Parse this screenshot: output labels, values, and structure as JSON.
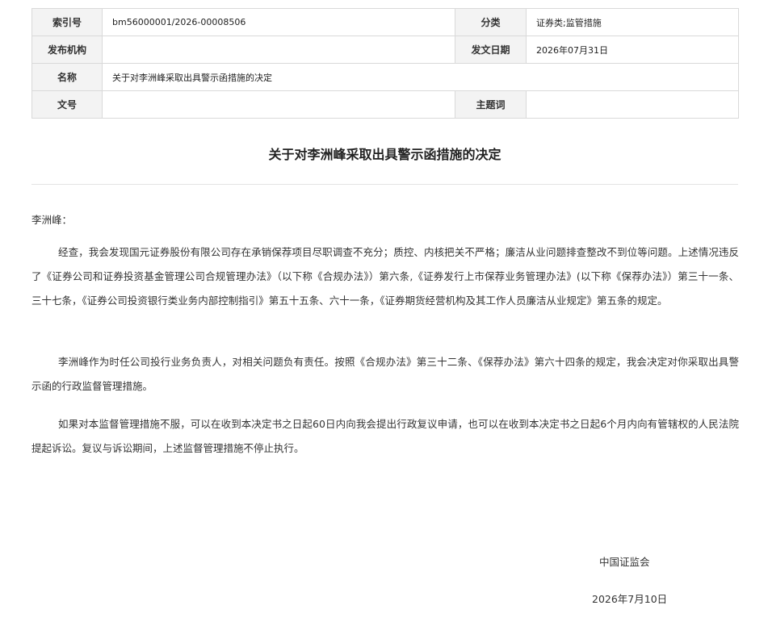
{
  "meta": {
    "index_label": "索引号",
    "index_value": "bm56000001/2026-00008506",
    "category_label": "分类",
    "category_value": "证券类;监管措施",
    "issuer_label": "发布机构",
    "issuer_value": "",
    "issue_date_label": "发文日期",
    "issue_date_value": "2026年07月31日",
    "name_label": "名称",
    "name_value": "关于对李洲峰采取出具警示函措施的决定",
    "doc_no_label": "文号",
    "doc_no_value": "",
    "subject_label": "主题词",
    "subject_value": ""
  },
  "document": {
    "title": "关于对李洲峰采取出具警示函措施的决定",
    "salutation": "李洲峰：",
    "paragraphs": [
      "经查，我会发现国元证券股份有限公司存在承销保荐项目尽职调查不充分；质控、内核把关不严格；廉洁从业问题排查整改不到位等问题。上述情况违反了《证券公司和证券投资基金管理公司合规管理办法》（以下称《合规办法》）第六条,《证券发行上市保荐业务管理办法》(以下称《保荐办法》）第三十一条、三十七条，《证券公司投资银行类业务内部控制指引》第五十五条、六十一条，《证券期货经营机构及其工作人员廉洁从业规定》第五条的规定。",
      "李洲峰作为时任公司投行业务负责人，对相关问题负有责任。按照《合规办法》第三十二条、《保荐办法》第六十四条的规定，我会决定对你采取出具警示函的行政监督管理措施。",
      "如果对本监督管理措施不服，可以在收到本决定书之日起60日内向我会提出行政复议申请，也可以在收到本决定书之日起6个月内向有管辖权的人民法院提起诉讼。复议与诉讼期间，上述监督管理措施不停止执行。"
    ],
    "signature_org": "中国证监会",
    "signature_date": "2026年7月10日"
  }
}
